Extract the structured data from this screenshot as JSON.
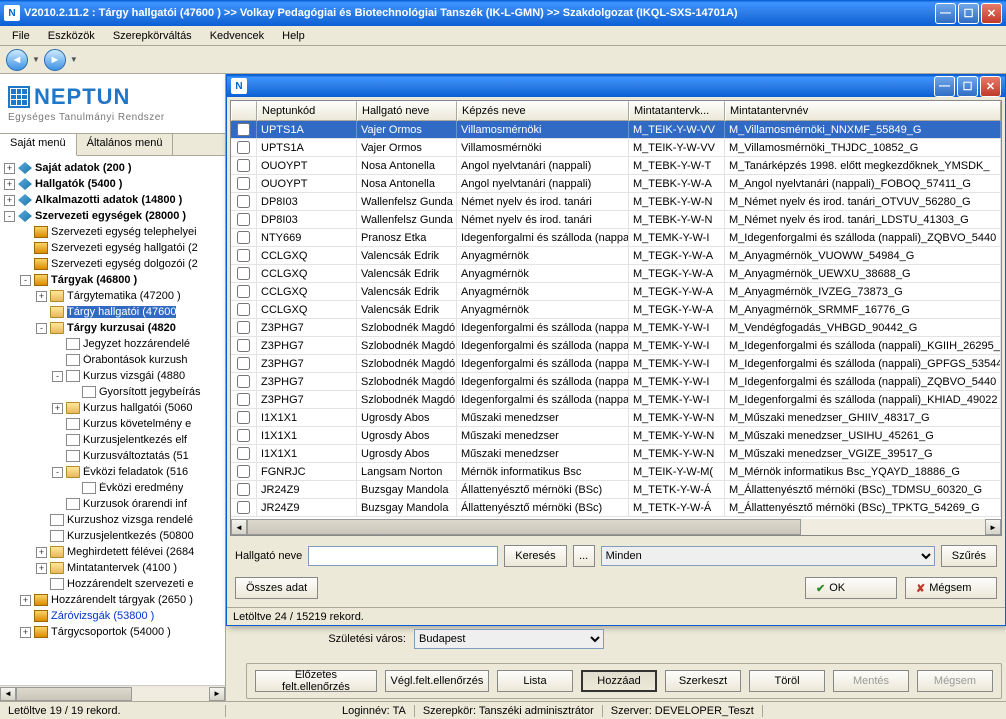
{
  "window": {
    "title": "V2010.2.11.2 : Tárgy hallgatói (47600  )   >> Volkay Pedagógiai és Biotechnológiai Tanszék (IK-L-GMN) >> Szakdolgozat (IKQL-SXS-14701A)"
  },
  "menu": [
    "File",
    "Eszközök",
    "Szerepkörváltás",
    "Kedvencek",
    "Help"
  ],
  "logo": {
    "text": "NEPTUN",
    "sub": "Egységes Tanulmányi Rendszer"
  },
  "side_tabs": {
    "a": "Saját menü",
    "b": "Általános menü"
  },
  "tree": [
    {
      "d": 0,
      "exp": "+",
      "ico": "diamond",
      "lbl": "Saját adatok (200  )",
      "bold": true
    },
    {
      "d": 0,
      "exp": "+",
      "ico": "diamond",
      "lbl": "Hallgatók (5400  )",
      "bold": true
    },
    {
      "d": 0,
      "exp": "+",
      "ico": "diamond",
      "lbl": "Alkalmazotti adatok (14800  )",
      "bold": true
    },
    {
      "d": 0,
      "exp": "-",
      "ico": "diamond",
      "lbl": "Szervezeti egységek (28000  )",
      "bold": true
    },
    {
      "d": 1,
      "exp": "",
      "ico": "org",
      "lbl": "Szervezeti egység telephelyei"
    },
    {
      "d": 1,
      "exp": "",
      "ico": "org",
      "lbl": "Szervezeti egység hallgatói (2"
    },
    {
      "d": 1,
      "exp": "",
      "ico": "org",
      "lbl": "Szervezeti egység dolgozói (2"
    },
    {
      "d": 1,
      "exp": "-",
      "ico": "org",
      "lbl": "Tárgyak (46800  )",
      "bold": true
    },
    {
      "d": 2,
      "exp": "+",
      "ico": "folder",
      "lbl": "Tárgytematika (47200  )"
    },
    {
      "d": 2,
      "exp": "",
      "ico": "folder",
      "lbl": "Tárgy hallgatói (47600",
      "sel": true
    },
    {
      "d": 2,
      "exp": "-",
      "ico": "folder",
      "lbl": "Tárgy kurzusai (4820",
      "bold": true
    },
    {
      "d": 3,
      "exp": "",
      "ico": "page",
      "lbl": "Jegyzet hozzárendelé"
    },
    {
      "d": 3,
      "exp": "",
      "ico": "page",
      "lbl": "Órabontások kurzush"
    },
    {
      "d": 3,
      "exp": "-",
      "ico": "page",
      "lbl": "Kurzus vizsgái (4880"
    },
    {
      "d": 4,
      "exp": "",
      "ico": "page",
      "lbl": "Gyorsított jegybeírás"
    },
    {
      "d": 3,
      "exp": "+",
      "ico": "folder",
      "lbl": "Kurzus hallgatói (5060"
    },
    {
      "d": 3,
      "exp": "",
      "ico": "page",
      "lbl": "Kurzus követelmény e"
    },
    {
      "d": 3,
      "exp": "",
      "ico": "page",
      "lbl": "Kurzusjelentkezés elf"
    },
    {
      "d": 3,
      "exp": "",
      "ico": "page",
      "lbl": "Kurzusváltoztatás (51"
    },
    {
      "d": 3,
      "exp": "-",
      "ico": "folder",
      "lbl": "Évközi feladatok (516"
    },
    {
      "d": 4,
      "exp": "",
      "ico": "page",
      "lbl": "Évközi eredmény"
    },
    {
      "d": 3,
      "exp": "",
      "ico": "page",
      "lbl": "Kurzusok órarendi inf"
    },
    {
      "d": 2,
      "exp": "",
      "ico": "page",
      "lbl": "Kurzushoz vizsga rendelé"
    },
    {
      "d": 2,
      "exp": "",
      "ico": "page",
      "lbl": "Kurzusjelentkezés (50800"
    },
    {
      "d": 2,
      "exp": "+",
      "ico": "folder",
      "lbl": "Meghirdetett félévei (2684"
    },
    {
      "d": 2,
      "exp": "+",
      "ico": "folder",
      "lbl": "Mintatantervek (4100  )"
    },
    {
      "d": 2,
      "exp": "",
      "ico": "page",
      "lbl": "Hozzárendelt szervezeti e"
    },
    {
      "d": 1,
      "exp": "+",
      "ico": "org",
      "lbl": "Hozzárendelt tárgyak (2650  )"
    },
    {
      "d": 1,
      "exp": "",
      "ico": "org",
      "lbl": "Záróvizsgák (53800  )",
      "link": true
    },
    {
      "d": 1,
      "exp": "+",
      "ico": "org",
      "lbl": "Tárgycsoportok (54000  )"
    }
  ],
  "dialog": {
    "headers": {
      "chk": "",
      "a": "Neptunkód",
      "b": "Hallgató neve",
      "c": "Képzés neve",
      "d": "Mintatantervk...",
      "e": "Mintatantervnév"
    },
    "rows": [
      {
        "a": "UPTS1A",
        "b": "Vajer Ormos",
        "c": "Villamosmérnöki",
        "d": "M_TEIK-Y-W-VV",
        "e": "M_Villamosmérnöki_NNXMF_55849_G",
        "sel": true
      },
      {
        "a": "UPTS1A",
        "b": "Vajer Ormos",
        "c": "Villamosmérnöki",
        "d": "M_TEIK-Y-W-VV",
        "e": "M_Villamosmérnöki_THJDC_10852_G"
      },
      {
        "a": "OUOYPT",
        "b": "Nosa Antonella",
        "c": "Angol nyelvtanári (nappali)",
        "d": "M_TEBK-Y-W-T",
        "e": "M_Tanárképzés 1998. előtt megkezdőknek_YMSDK_"
      },
      {
        "a": "OUOYPT",
        "b": "Nosa Antonella",
        "c": "Angol nyelvtanári (nappali)",
        "d": "M_TEBK-Y-W-A",
        "e": "M_Angol nyelvtanári (nappali)_FOBOQ_57411_G"
      },
      {
        "a": "DP8I03",
        "b": "Wallenfelsz Gunda",
        "c": "Német nyelv és irod. tanári",
        "d": "M_TEBK-Y-W-N",
        "e": "M_Német nyelv és irod. tanári_OTVUV_56280_G"
      },
      {
        "a": "DP8I03",
        "b": "Wallenfelsz Gunda",
        "c": "Német nyelv és irod. tanári",
        "d": "M_TEBK-Y-W-N",
        "e": "M_Német nyelv és irod. tanári_LDSTU_41303_G"
      },
      {
        "a": "NTY669",
        "b": "Pranosz Etka",
        "c": "Idegenforgalmi és szálloda (nappali)",
        "d": "M_TEMK-Y-W-I",
        "e": "M_Idegenforgalmi és szálloda (nappali)_ZQBVO_5440"
      },
      {
        "a": "CCLGXQ",
        "b": "Valencsák Edrik",
        "c": "Anyagmérnök",
        "d": "M_TEGK-Y-W-A",
        "e": "M_Anyagmérnök_VUOWW_54984_G"
      },
      {
        "a": "CCLGXQ",
        "b": "Valencsák Edrik",
        "c": "Anyagmérnök",
        "d": "M_TEGK-Y-W-A",
        "e": "M_Anyagmérnök_UEWXU_38688_G"
      },
      {
        "a": "CCLGXQ",
        "b": "Valencsák Edrik",
        "c": "Anyagmérnök",
        "d": "M_TEGK-Y-W-A",
        "e": "M_Anyagmérnök_IVZEG_73873_G"
      },
      {
        "a": "CCLGXQ",
        "b": "Valencsák Edrik",
        "c": "Anyagmérnök",
        "d": "M_TEGK-Y-W-A",
        "e": "M_Anyagmérnök_SRMMF_16776_G"
      },
      {
        "a": "Z3PHG7",
        "b": "Szlobodnék Magdó",
        "c": "Idegenforgalmi és szálloda (nappali)",
        "d": "M_TEMK-Y-W-I",
        "e": "M_Vendégfogadás_VHBGD_90442_G"
      },
      {
        "a": "Z3PHG7",
        "b": "Szlobodnék Magdó",
        "c": "Idegenforgalmi és szálloda (nappali)",
        "d": "M_TEMK-Y-W-I",
        "e": "M_Idegenforgalmi és szálloda (nappali)_KGIIH_26295_"
      },
      {
        "a": "Z3PHG7",
        "b": "Szlobodnék Magdó",
        "c": "Idegenforgalmi és szálloda (nappali)",
        "d": "M_TEMK-Y-W-I",
        "e": "M_Idegenforgalmi és szálloda (nappali)_GPFGS_53544"
      },
      {
        "a": "Z3PHG7",
        "b": "Szlobodnék Magdó",
        "c": "Idegenforgalmi és szálloda (nappali)",
        "d": "M_TEMK-Y-W-I",
        "e": "M_Idegenforgalmi és szálloda (nappali)_ZQBVO_5440"
      },
      {
        "a": "Z3PHG7",
        "b": "Szlobodnék Magdó",
        "c": "Idegenforgalmi és szálloda (nappali)",
        "d": "M_TEMK-Y-W-I",
        "e": "M_Idegenforgalmi és szálloda (nappali)_KHIAD_49022"
      },
      {
        "a": "I1X1X1",
        "b": "Ugrosdy Abos",
        "c": "Műszaki menedzser",
        "d": "M_TEMK-Y-W-N",
        "e": "M_Műszaki menedzser_GHIIV_48317_G"
      },
      {
        "a": "I1X1X1",
        "b": "Ugrosdy Abos",
        "c": "Műszaki menedzser",
        "d": "M_TEMK-Y-W-N",
        "e": "M_Műszaki menedzser_USIHU_45261_G"
      },
      {
        "a": "I1X1X1",
        "b": "Ugrosdy Abos",
        "c": "Műszaki menedzser",
        "d": "M_TEMK-Y-W-N",
        "e": "M_Műszaki menedzser_VGIZE_39517_G"
      },
      {
        "a": "FGNRJC",
        "b": "Langsam Norton",
        "c": "Mérnök informatikus Bsc",
        "d": "M_TEIK-Y-W-M(",
        "e": "M_Mérnök informatikus Bsc_YQAYD_18886_G"
      },
      {
        "a": "JR24Z9",
        "b": "Buzsgay Mandola",
        "c": "Állattenyésztő mérnöki (BSc)",
        "d": "M_TETK-Y-W-Á",
        "e": "M_Állattenyésztő mérnöki (BSc)_TDMSU_60320_G"
      },
      {
        "a": "JR24Z9",
        "b": "Buzsgay Mandola",
        "c": "Állattenyésztő mérnöki (BSc)",
        "d": "M_TETK-Y-W-Á",
        "e": "M_Állattenyésztő mérnöki (BSc)_TPKTG_54269_G"
      }
    ],
    "filter": {
      "label": "Hallgató neve",
      "search_btn": "Keresés",
      "dots": "...",
      "dropdown": "Minden",
      "filter_btn": "Szűrés"
    },
    "all_data_btn": "Összes adat",
    "ok": "OK",
    "cancel": "Mégsem",
    "status": "Letöltve 24 / 15219 rekord."
  },
  "under": {
    "birth_city_label": "Születési város:",
    "birth_city_value": "Budapest",
    "buttons": {
      "pre": "Előzetes felt.ellenőrzés",
      "final": "Végl.felt.ellenőrzés",
      "list": "Lista",
      "add": "Hozzáad",
      "edit": "Szerkeszt",
      "del": "Töröl",
      "save": "Mentés",
      "cancel": "Mégsem"
    }
  },
  "status": {
    "left": "Letöltve 19 / 19 rekord.",
    "login": "Loginnév: TA",
    "role": "Szerepkör: Tanszéki adminisztrátor",
    "server": "Szerver: DEVELOPER_Teszt"
  }
}
